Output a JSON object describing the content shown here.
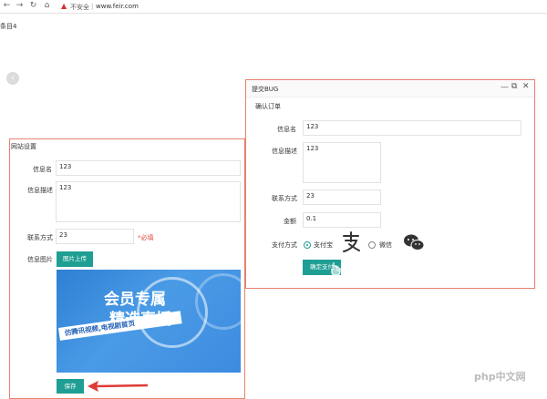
{
  "browser": {
    "nav_back_icon": "arrow-left-icon",
    "nav_forward_icon": "arrow-right-icon",
    "reload_icon": "reload-icon",
    "home_icon": "home-icon",
    "security_label": "不安全",
    "url": "www.feir.com"
  },
  "page": {
    "tab_label": "条目4",
    "back_icon": "chevron-left-icon"
  },
  "site_form": {
    "title": "网站设置",
    "info_name_label": "信息名",
    "info_name_value": "123",
    "info_desc_label": "信息描述",
    "info_desc_value": "123",
    "contact_label": "联系方式",
    "contact_value": "23",
    "required_hint": "*必填",
    "image_label": "信息图片",
    "upload_button": "图片上传",
    "banner": {
      "headline_line1": "会员专属",
      "headline_line2": "精选直播",
      "subtitle": "仿腾讯视频,电视剧首页"
    },
    "save_button": "保存"
  },
  "modal": {
    "title": "提交BUG",
    "minimize_icon": "minimize-icon",
    "maximize_icon": "maximize-icon",
    "close_icon": "close-icon",
    "section_title": "确认订单",
    "info_name_label": "信息名",
    "info_name_value": "123",
    "info_desc_label": "信息描述",
    "info_desc_value": "123",
    "contact_label": "联系方式",
    "contact_value": "23",
    "amount_label": "金额",
    "amount_value": "0.1",
    "pay_method_label": "支付方式",
    "pay_options": [
      {
        "label": "支付宝",
        "selected": true,
        "icon": "alipay-icon"
      },
      {
        "label": "微信",
        "selected": false,
        "icon": "wechat-icon"
      }
    ],
    "confirm_button": "确定支付"
  },
  "watermark": "php中文网",
  "colors": {
    "accent": "#1f9e93",
    "panel_border": "#e8836e",
    "required": "#e04a3a",
    "arrow": "#e03a36"
  }
}
